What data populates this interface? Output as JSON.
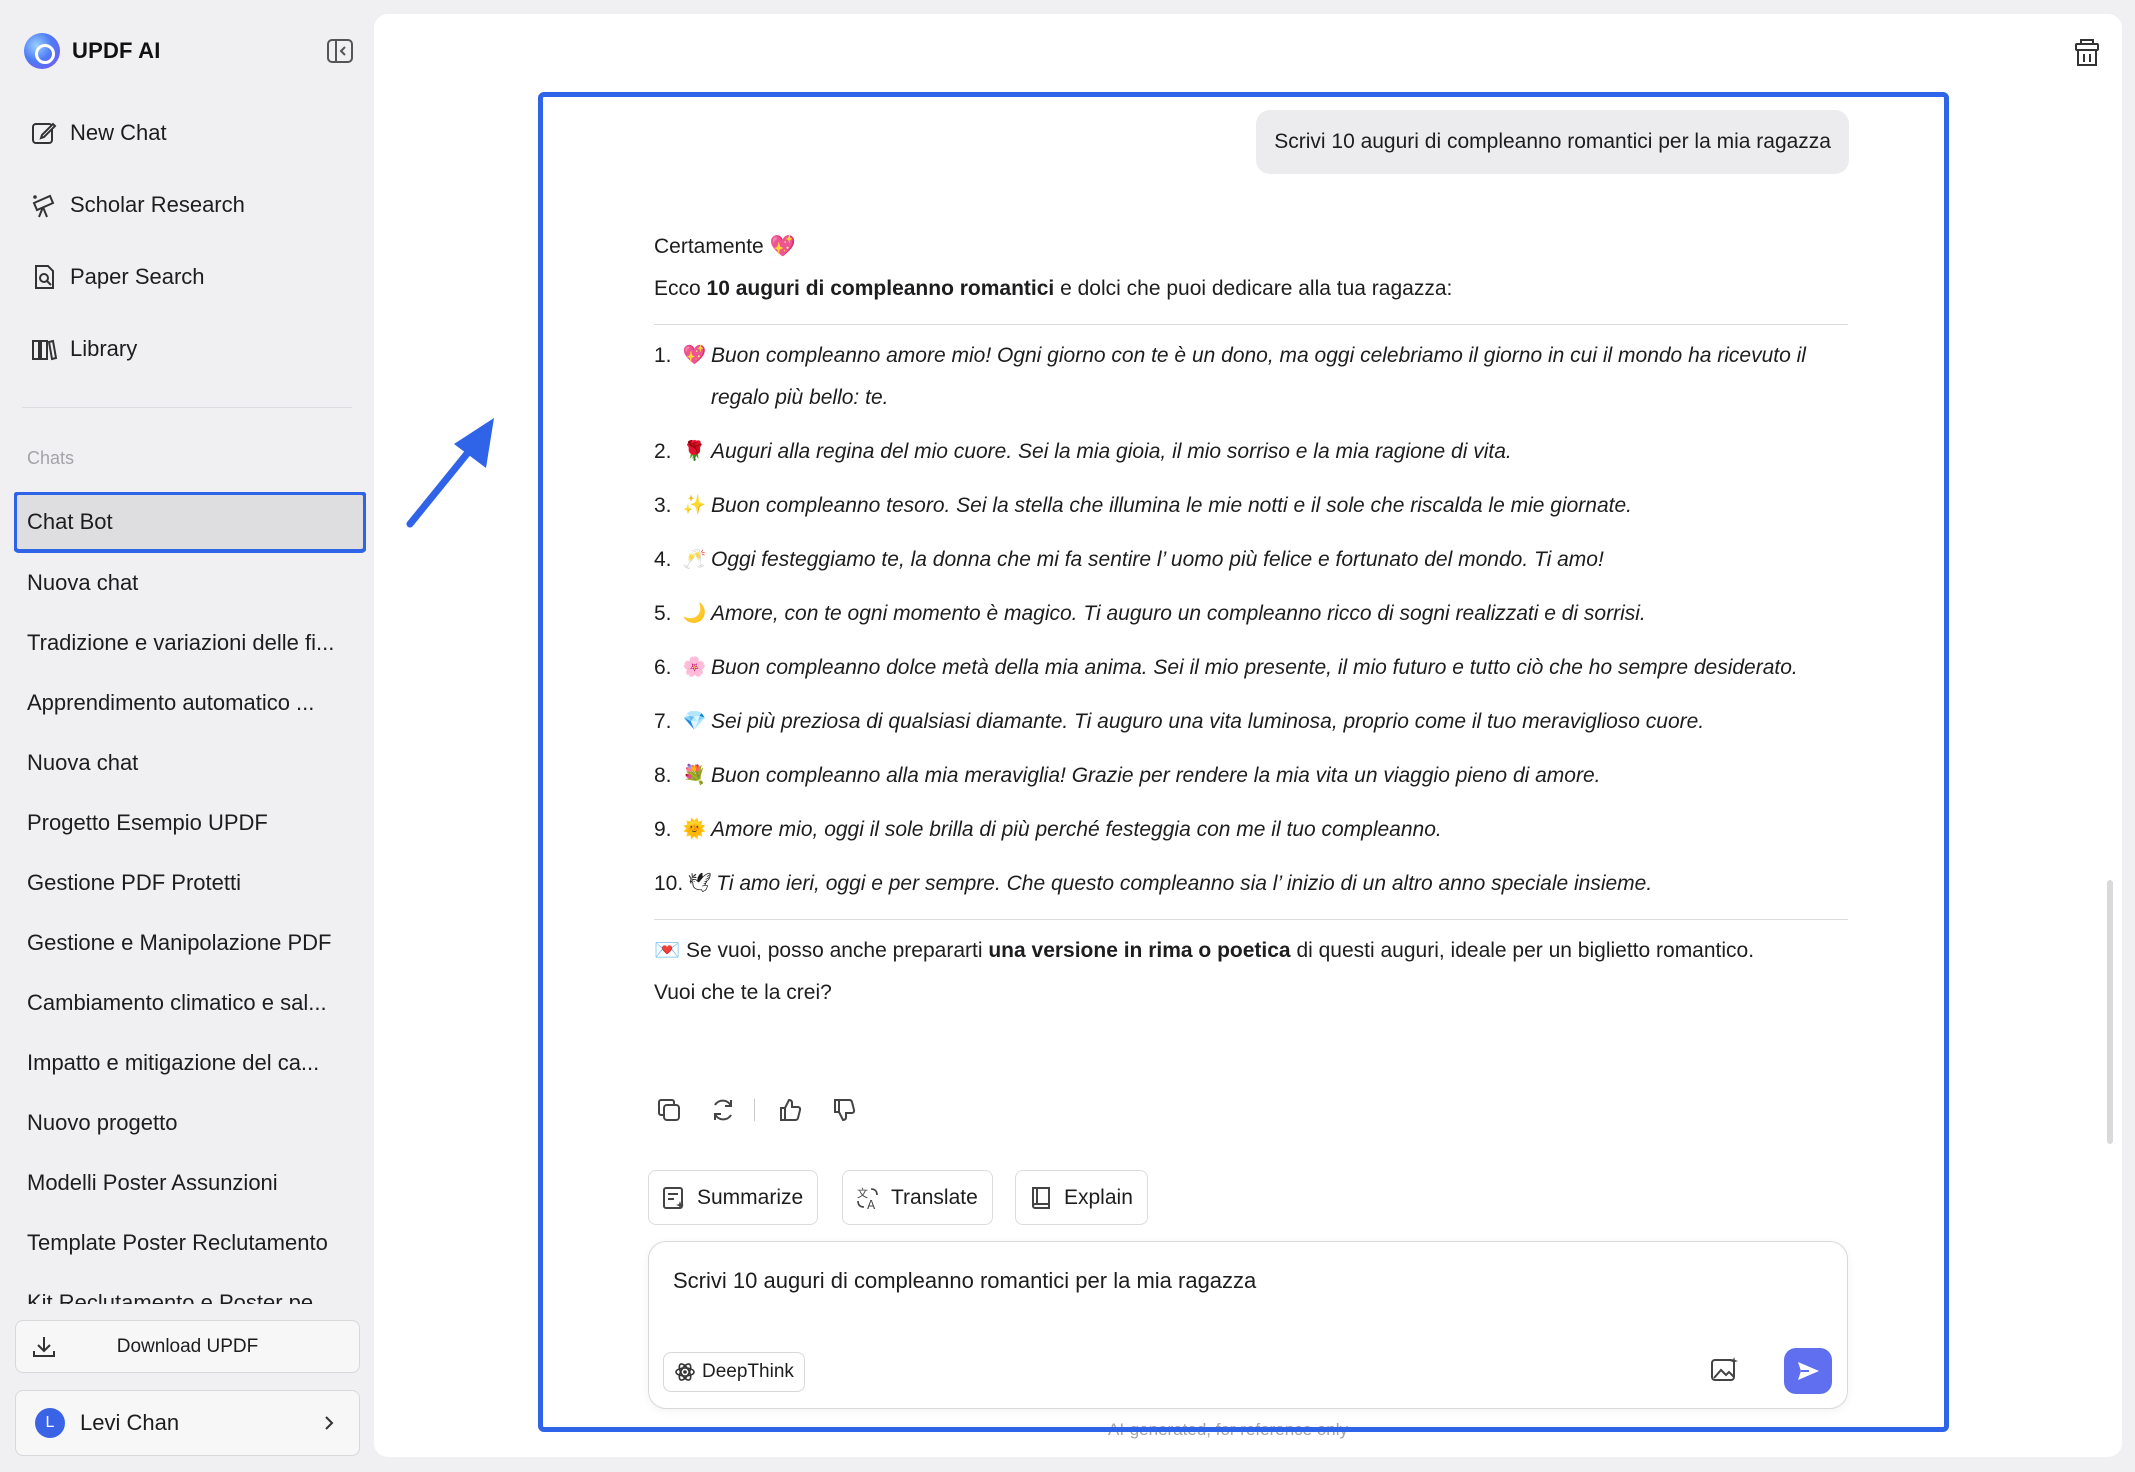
{
  "app": {
    "name": "UPDF AI"
  },
  "nav": [
    {
      "label": "New Chat",
      "icon": "edit-icon"
    },
    {
      "label": "Scholar Research",
      "icon": "telescope-icon"
    },
    {
      "label": "Paper Search",
      "icon": "document-search-icon"
    },
    {
      "label": "Library",
      "icon": "library-icon"
    }
  ],
  "chats_label": "Chats",
  "chats": [
    "Chat Bot",
    "Nuova chat",
    "Tradizione e variazioni delle fi...",
    "Apprendimento automatico ...",
    "Nuova chat",
    "Progetto Esempio UPDF",
    "Gestione PDF Protetti",
    "Gestione e Manipolazione PDF",
    "Cambiamento climatico e sal...",
    "Impatto e mitigazione del ca...",
    "Nuovo progetto",
    "Modelli Poster Assunzioni",
    "Template Poster Reclutamento",
    "Kit Reclutamento e Poster pe..."
  ],
  "download_label": "Download UPDF",
  "user": {
    "initial": "L",
    "name": "Levi Chan"
  },
  "conversation": {
    "user_message": "Scrivi 10 auguri di compleanno romantici per la mia ragazza",
    "reply_intro": "Certamente",
    "reply_intro_emoji": "💖",
    "reply_lead_before": "Ecco ",
    "reply_lead_bold": "10 auguri di compleanno romantici",
    "reply_lead_after": " e dolci che puoi dedicare alla tua ragazza:",
    "items": [
      {
        "num": "1.",
        "emoji": "💖",
        "text": "Buon compleanno amore mio! Ogni giorno con te è un dono, ma oggi celebriamo il giorno in cui il mondo ha ricevuto il regalo più bello: te."
      },
      {
        "num": "2.",
        "emoji": "🌹",
        "text": "Auguri alla regina del mio cuore. Sei la mia gioia, il mio sorriso e la mia ragione di vita."
      },
      {
        "num": "3.",
        "emoji": "✨",
        "text": "Buon compleanno tesoro. Sei la stella che illumina le mie notti e il sole che riscalda le mie giornate."
      },
      {
        "num": "4.",
        "emoji": "🥂",
        "text": "Oggi festeggiamo te, la donna che mi fa sentire l’ uomo più felice e fortunato del mondo. Ti amo!"
      },
      {
        "num": "5.",
        "emoji": "🌙",
        "text": "Amore, con te ogni momento è magico. Ti auguro un compleanno ricco di sogni realizzati e di sorrisi."
      },
      {
        "num": "6.",
        "emoji": "🌸",
        "text": "Buon compleanno dolce metà della mia anima. Sei il mio presente, il mio futuro e tutto ciò che ho sempre desiderato."
      },
      {
        "num": "7.",
        "emoji": "💎",
        "text": "Sei più preziosa di qualsiasi diamante. Ti auguro una vita luminosa, proprio come il tuo meraviglioso cuore."
      },
      {
        "num": "8.",
        "emoji": "💐",
        "text": "Buon compleanno alla mia meraviglia! Grazie per rendere la mia vita un viaggio pieno di amore."
      },
      {
        "num": "9.",
        "emoji": "🌞",
        "text": "Amore mio, oggi il sole brilla di più perché festeggia con me il tuo compleanno."
      },
      {
        "num": "10.",
        "emoji": "🕊",
        "text": "Ti amo ieri, oggi e per sempre. Che questo compleanno sia l’ inizio di un altro anno speciale insieme."
      }
    ],
    "closing_emoji": "💌",
    "closing_before": " Se vuoi, posso anche prepararti ",
    "closing_bold": "una versione in rima o poetica",
    "closing_after": " di questi auguri, ideale per un biglietto romantico.",
    "closing_line2": "Vuoi che te la crei?"
  },
  "quick_actions": {
    "summarize": "Summarize",
    "translate": "Translate",
    "explain": "Explain"
  },
  "composer": {
    "value": "Scrivi 10 auguri di compleanno romantici per la mia ragazza",
    "deepthink_label": "DeepThink"
  },
  "footnote": "AI-generated, for reference only",
  "colors": {
    "accent": "#2f64e8",
    "send": "#5f6ff0",
    "sidebar_bg": "#f0f0f2"
  }
}
